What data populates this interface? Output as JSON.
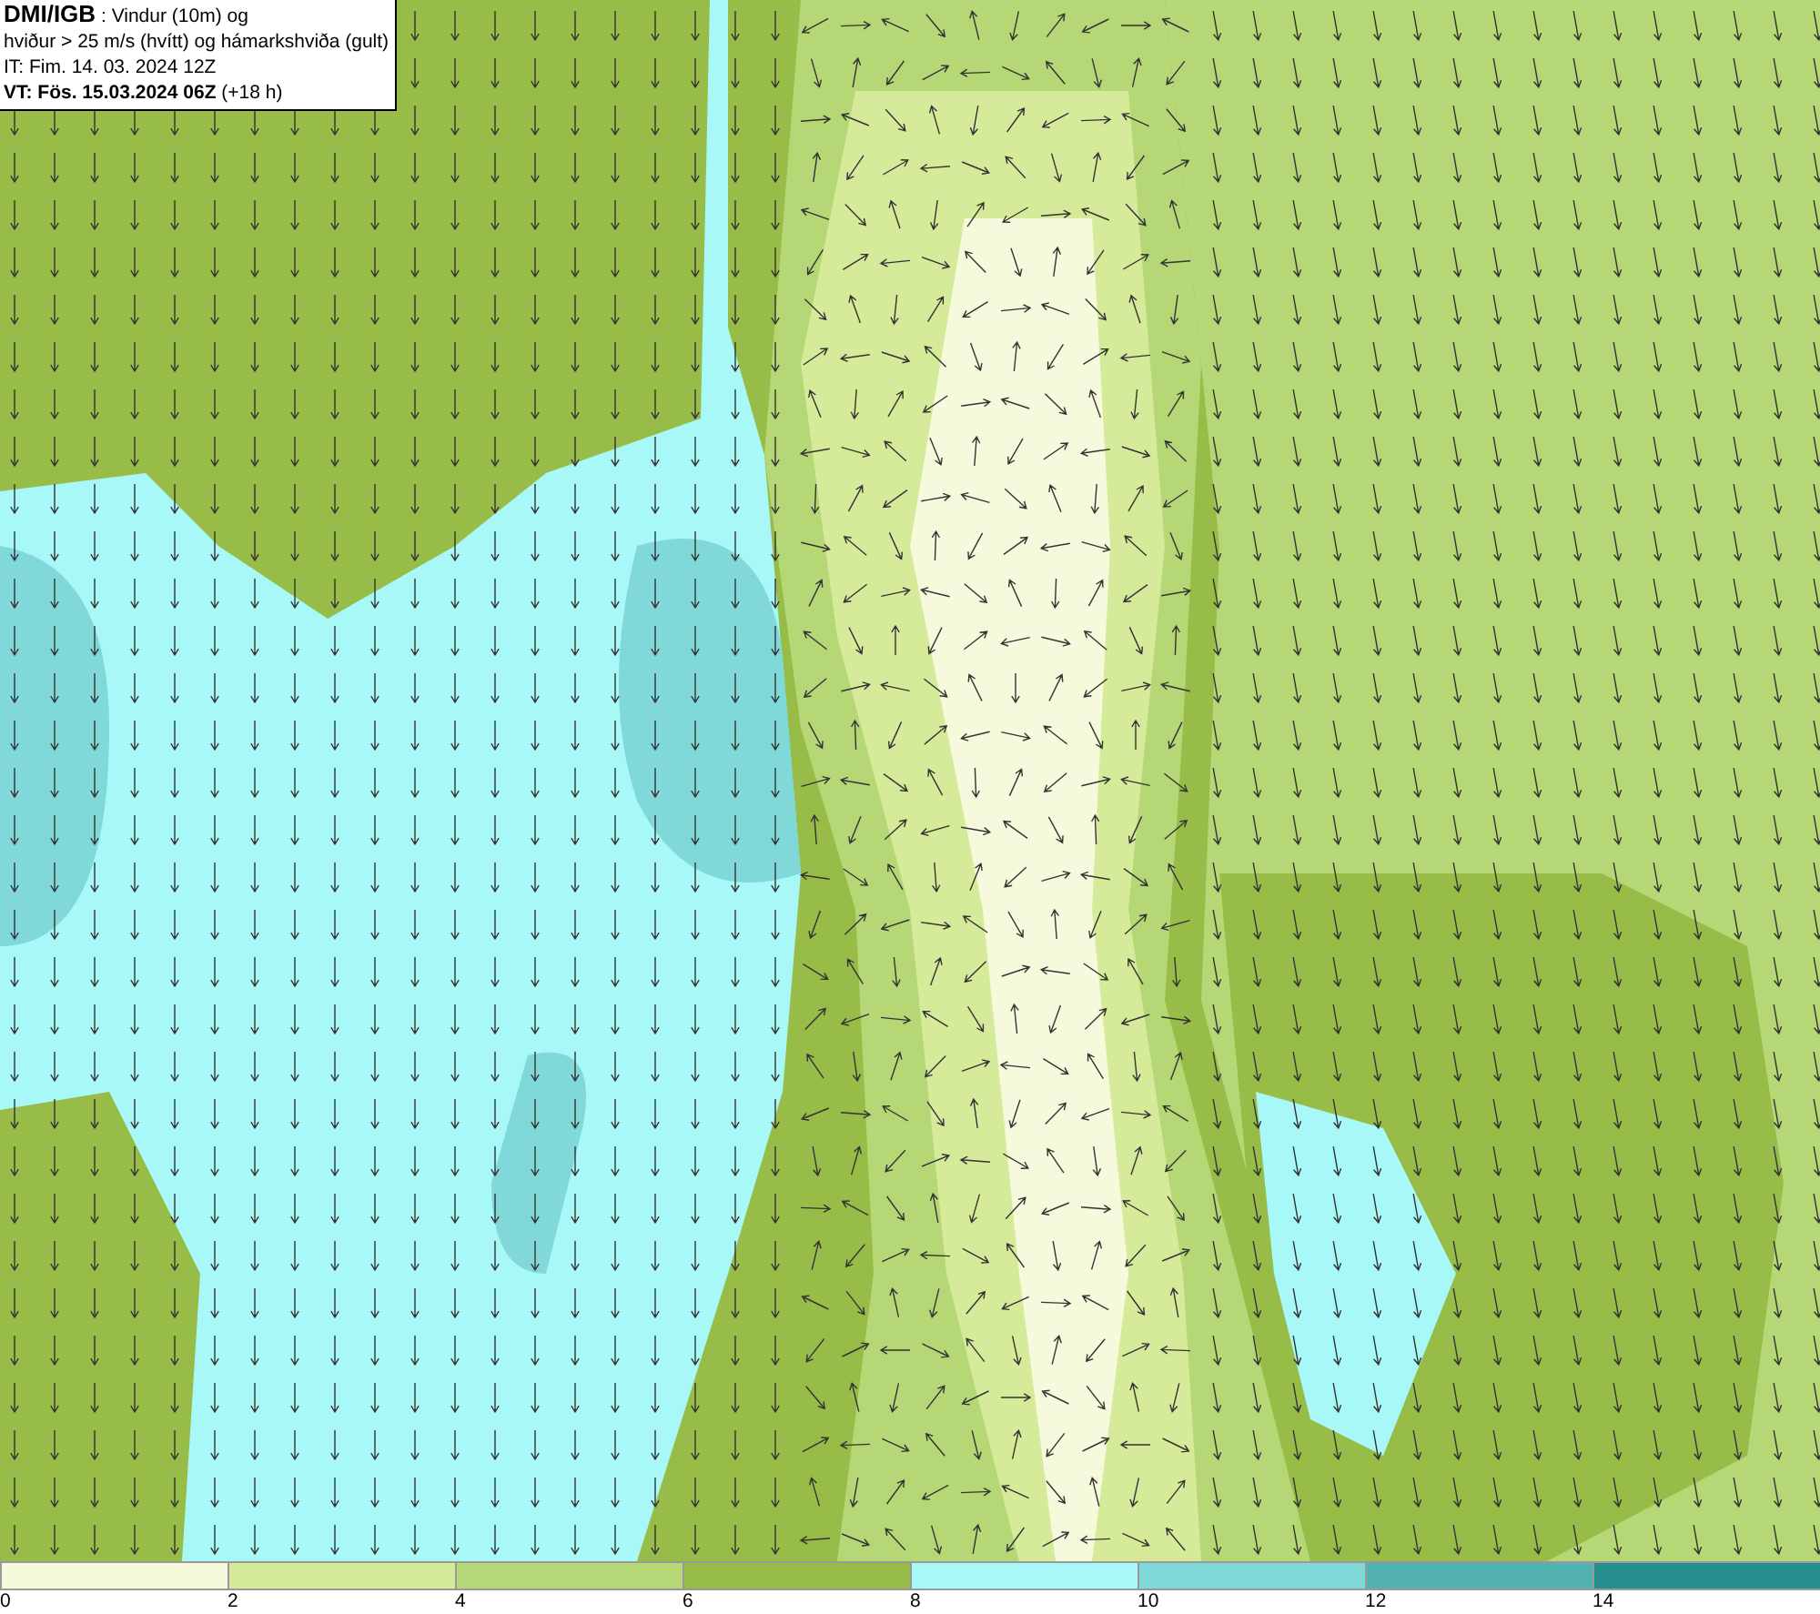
{
  "header": {
    "source": "DMI/IGB",
    "title": " : Vindur (10m) og",
    "subtitle": "hviður > 25 m/s (hvítt) og hámarkshviða (gult)",
    "issued": "IT: Fim. 14. 03. 2024 12Z",
    "valid_bold": "VT: Fös. 15.03.2024 06Z",
    "valid_offset": " (+18 h)"
  },
  "legend": {
    "segments": [
      {
        "color": "#f5fadc",
        "label": "0"
      },
      {
        "color": "#d6eb9a",
        "label": "2"
      },
      {
        "color": "#b6d776",
        "label": "4"
      },
      {
        "color": "#98bc48",
        "label": "6"
      },
      {
        "color": "#a8f8f8",
        "label": "8"
      },
      {
        "color": "#80d8d8",
        "label": "10"
      },
      {
        "color": "#52b2b2",
        "label": "12"
      },
      {
        "color": "#258f8f",
        "label": "14"
      }
    ]
  }
}
